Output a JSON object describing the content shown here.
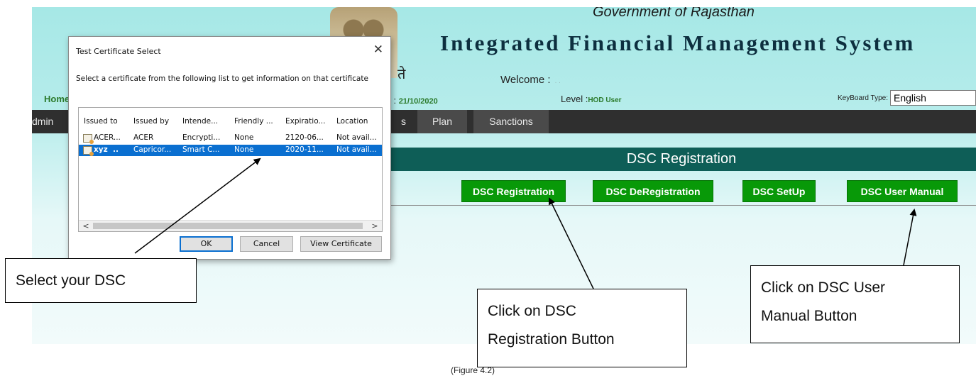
{
  "page": {
    "gov_title": "Government of Rajasthan",
    "system_title": "Integrated Financial Management System",
    "emblem_caption": "ते",
    "welcome_label": "Welcome :",
    "welcome_name": ". .",
    "home_link": "Home",
    "date_label": "te : ",
    "date_value": "21/10/2020",
    "level_label": "Level :",
    "level_value": "HOD User",
    "keyboard_label": "KeyBoard Type:",
    "keyboard_value": "English"
  },
  "menu": {
    "items": [
      "dmin",
      "s",
      "Plan",
      "Sanctions"
    ]
  },
  "section": {
    "title": "DSC Registration",
    "buttons": [
      "DSC Registration",
      "DSC DeRegistration",
      "DSC SetUp",
      "DSC User Manual"
    ],
    "colors": {
      "button_green": "#089908",
      "section_teal": "#0e5e57"
    }
  },
  "dialog": {
    "title": "Test Certificate Select",
    "close_glyph": "✕",
    "instruction": "Select a certificate from the following list to get information on that certificate",
    "columns": [
      "Issued to",
      "Issued by",
      "Intende...",
      "Friendly ...",
      "Expiratio...",
      "Location"
    ],
    "rows": [
      [
        "ACER...",
        "ACER",
        "Encrypti...",
        "None",
        "2120-06...",
        "Not avail..."
      ],
      [
        "xyz  ..",
        "Capricor...",
        "Smart C...",
        "None",
        "2020-11...",
        "Not avail..."
      ]
    ],
    "selected_row": 1,
    "buttons": {
      "ok": "OK",
      "cancel": "Cancel",
      "view": "View Certificate"
    },
    "scroll_left": "<",
    "scroll_right": ">"
  },
  "callouts": {
    "select_dsc": "Select your DSC",
    "registration_line1": "Click on DSC",
    "registration_line2": "Registration Button",
    "manual_line1": "Click on DSC User",
    "manual_line2": "Manual Button"
  },
  "figure_caption": "(Figure 4.2)"
}
